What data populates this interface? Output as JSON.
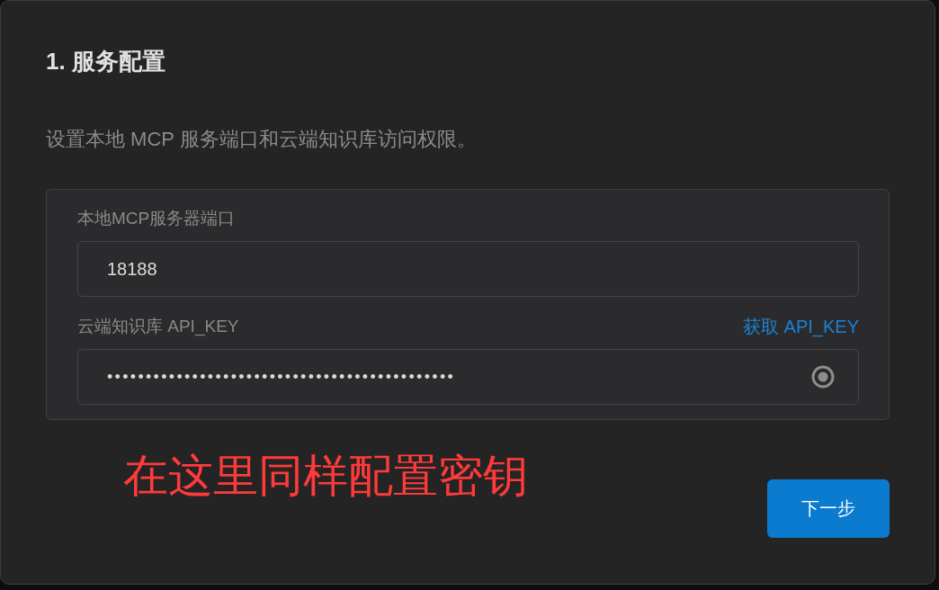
{
  "step_title": "1. 服务配置",
  "description": "设置本地 MCP 服务端口和云端知识库访问权限。",
  "fields": [
    {
      "kind": "text",
      "label": "本地MCP服务器端口",
      "value": "18188"
    },
    {
      "kind": "password",
      "label": "云端知识库 API_KEY",
      "link": "获取 API_KEY",
      "value": "•••••••••••••••••••••••••••••••••••••••••••••"
    }
  ],
  "annotation": "在这里同样配置密钥",
  "next_button": "下一步"
}
